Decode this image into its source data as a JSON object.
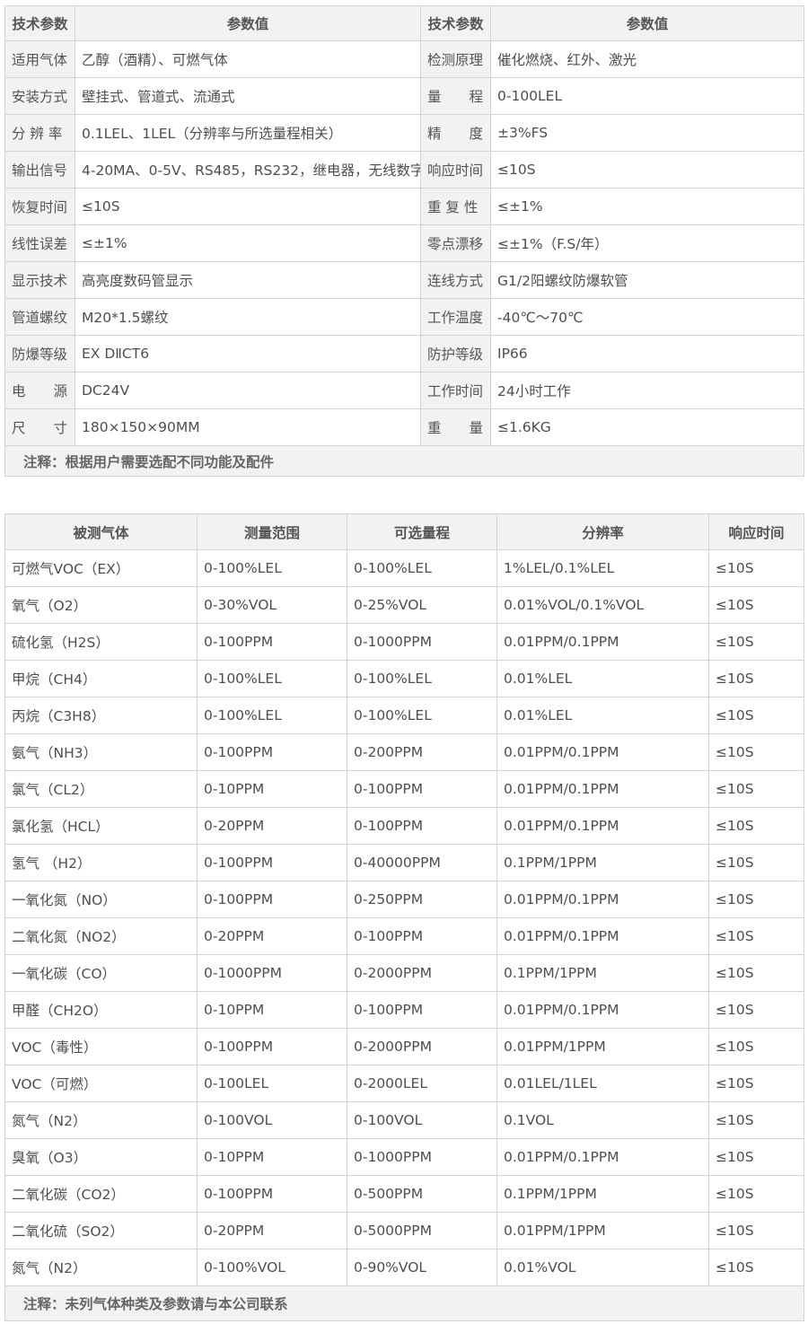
{
  "spec_table": {
    "headers": [
      "技术参数",
      "参数值",
      "技术参数",
      "参数值"
    ],
    "rows": [
      [
        "适用气体",
        "乙醇（酒精）、可燃气体",
        "检测原理",
        "催化燃烧、红外、激光"
      ],
      [
        "安装方式",
        "壁挂式、管道式、流通式",
        "量　　程",
        "0-100LEL"
      ],
      [
        "分 辨 率",
        "0.1LEL、1LEL（分辨率与所选量程相关）",
        "精　　度",
        "±3%FS"
      ],
      [
        "输出信号",
        "4-20MA、0-5V、RS485，RS232，继电器，无线数字",
        "响应时间",
        "≤10S"
      ],
      [
        "恢复时间",
        "≤10S",
        "重 复 性",
        "≤±1%"
      ],
      [
        "线性误差",
        "≤±1%",
        "零点漂移",
        "≤±1%（F.S/年）"
      ],
      [
        "显示技术",
        "高亮度数码管显示",
        "连线方式",
        "G1/2阳螺纹防爆软管"
      ],
      [
        "管道螺纹",
        " M20*1.5螺纹",
        "工作温度",
        "-40℃～70℃"
      ],
      [
        "防爆等级",
        "EX DⅡCT6",
        "防护等级",
        "IP66"
      ],
      [
        "电　　源",
        "DC24V",
        "工作时间",
        "24小时工作"
      ],
      [
        "尺　　寸",
        "180×150×90MM",
        "重　　量",
        "≤1.6KG"
      ]
    ],
    "note": "注释：根据用户需要选配不同功能及配件"
  },
  "gas_table": {
    "headers": [
      "被测气体",
      "测量范围",
      "可选量程",
      "分辨率",
      "响应时间"
    ],
    "rows": [
      [
        "可燃气VOC（EX）",
        "0-100%LEL",
        "0-100%LEL",
        "1%LEL/0.1%LEL",
        "≤10S"
      ],
      [
        "氧气（O2）",
        "0-30%VOL",
        "0-25%VOL",
        "0.01%VOL/0.1%VOL",
        "≤10S"
      ],
      [
        "硫化氢（H2S）",
        "0-100PPM",
        "0-1000PPM",
        "0.01PPM/0.1PPM",
        "≤10S"
      ],
      [
        "甲烷（CH4）",
        "0-100%LEL",
        "0-100%LEL",
        "0.01%LEL",
        "≤10S"
      ],
      [
        "丙烷（C3H8）",
        "0-100%LEL",
        "0-100%LEL",
        "0.01%LEL",
        "≤10S"
      ],
      [
        "氨气（NH3）",
        "0-100PPM",
        "0-200PPM",
        "0.01PPM/0.1PPM",
        "≤10S"
      ],
      [
        "氯气（CL2）",
        "0-10PPM",
        "0-100PPM",
        "0.01PPM/0.1PPM",
        "≤10S"
      ],
      [
        "氯化氢（HCL）",
        "0-20PPM",
        "0-100PPM",
        "0.01PPM/0.1PPM",
        "≤10S"
      ],
      [
        "氢气 （H2）",
        "0-100PPM",
        "0-40000PPM",
        "0.1PPM/1PPM",
        "≤10S"
      ],
      [
        "一氧化氮（NO）",
        "0-100PPM",
        "0-250PPM",
        "0.01PPM/0.1PPM",
        "≤10S"
      ],
      [
        "二氧化氮（NO2）",
        "0-20PPM",
        "0-100PPM",
        "0.01PPM/0.1PPM",
        "≤10S"
      ],
      [
        "一氧化碳（CO）",
        "0-1000PPM",
        "0-2000PPM",
        "0.1PPM/1PPM",
        "≤10S"
      ],
      [
        "甲醛（CH2O）",
        "0-10PPM",
        "0-100PPM",
        "0.01PPM/0.1PPM",
        "≤10S"
      ],
      [
        "VOC（毒性）",
        "0-100PPM",
        "0-2000PPM",
        "0.01PPM/1PPM",
        "≤10S"
      ],
      [
        "VOC（可燃）",
        "0-100LEL",
        "0-2000LEL",
        "0.01LEL/1LEL",
        "≤10S"
      ],
      [
        "氮气（N2）",
        "0-100VOL",
        "0-100VOL",
        "0.1VOL",
        "≤10S"
      ],
      [
        "臭氧（O3）",
        "0-10PPM",
        "0-1000PPM",
        "0.01PPM/0.1PPM",
        "≤10S"
      ],
      [
        "二氧化碳（CO2）",
        "0-100PPM",
        "0-500PPM",
        "0.1PPM/1PPM",
        "≤10S"
      ],
      [
        "二氧化硫（SO2）",
        "0-20PPM",
        "0-5000PPM",
        "0.01PPM/1PPM",
        "≤10S"
      ],
      [
        "氮气（N2）",
        "0-100%VOL",
        "0-90%VOL",
        "0.01%VOL",
        "≤10S"
      ]
    ],
    "note": "注释：未列气体种类及参数请与本公司联系"
  }
}
